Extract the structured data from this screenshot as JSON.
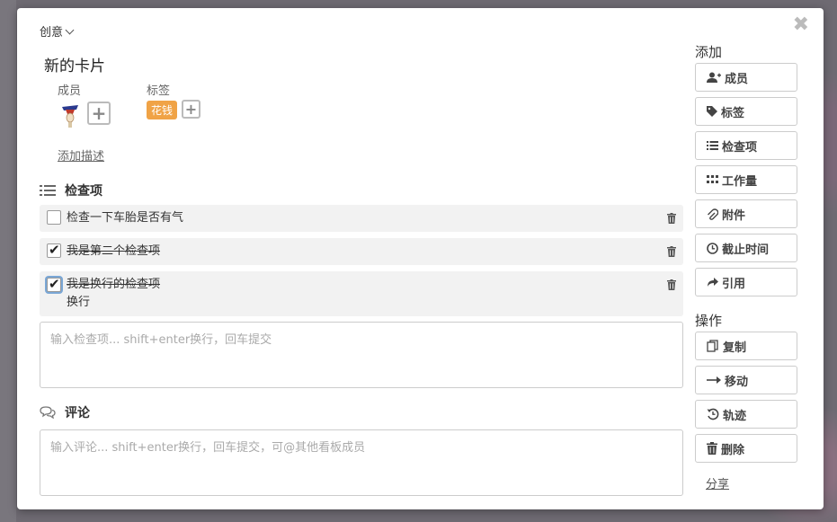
{
  "card": {
    "board_name": "创意",
    "title": "新的卡片",
    "members_label": "成员",
    "labels_label": "标签",
    "tag_text": "花钱",
    "tag_color": "#f0a346",
    "add_description": "添加描述"
  },
  "checklist": {
    "title": "检查项",
    "items": [
      {
        "text": "检查一下车胎是否有气",
        "checked": false
      },
      {
        "text": "我是第二个检查项",
        "checked": true
      },
      {
        "text": "我是换行的检查项",
        "text2": "换行",
        "checked": true
      }
    ],
    "input_placeholder": "输入检查项... shift+enter换行，回车提交"
  },
  "comments": {
    "title": "评论",
    "input_placeholder": "输入评论... shift+enter换行，回车提交，可@其他看板成员"
  },
  "sidebar": {
    "add_title": "添加",
    "add_buttons": [
      "成员",
      "标签",
      "检查项",
      "工作量",
      "附件",
      "截止时间",
      "引用"
    ],
    "actions_title": "操作",
    "action_buttons": [
      "复制",
      "移动",
      "轨迹",
      "删除"
    ],
    "share": "分享"
  }
}
